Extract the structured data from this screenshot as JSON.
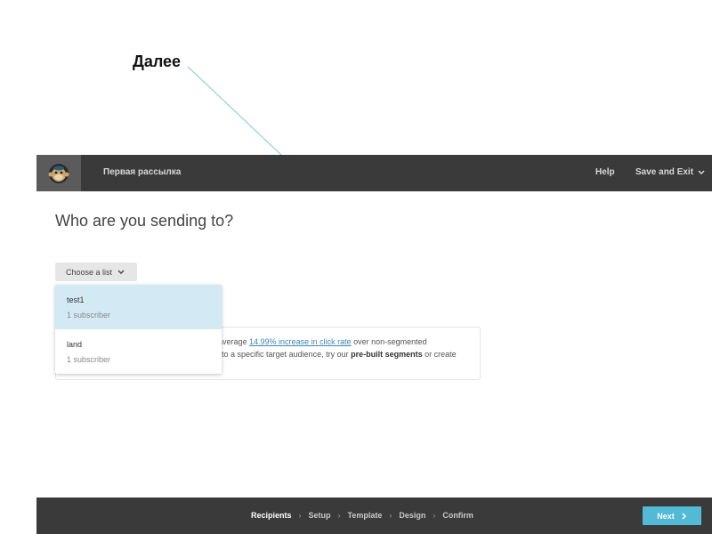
{
  "annotation": {
    "label": "Далее"
  },
  "header": {
    "campaign_name": "Первая рассылка",
    "help": "Help",
    "save_exit": "Save and Exit"
  },
  "main": {
    "heading": "Who are you sending to?",
    "choose_list": "Choose a list",
    "list_options": [
      {
        "name": "test1",
        "subscribers": "1 subscriber",
        "highlighted": true
      },
      {
        "name": "land",
        "subscribers": "1 subscriber",
        "highlighted": false
      }
    ],
    "info": {
      "line1_before": "average ",
      "line1_link": "14.99% increase in click rate",
      "line1_after": " over non-segmented",
      "line2_before": "to a specific target audience, try our ",
      "line2_bold": "pre-built segments",
      "line2_after": " or create"
    }
  },
  "footer": {
    "steps": [
      "Recipients",
      "Setup",
      "Template",
      "Design",
      "Confirm"
    ],
    "current_step": "Recipients",
    "next": "Next"
  },
  "colors": {
    "topbar": "#3a3a3a",
    "accent": "#52bad5",
    "dropdown_highlight": "#d3eaf4",
    "link": "#3f86b5",
    "annotation_line": "#7fc9cf"
  },
  "icons": {
    "logo": "mailchimp-monkey-icon",
    "save_exit_chevron": "chevron-down-icon",
    "choose_list_chevron": "chevron-down-icon",
    "step_separator": "chevron-right-icon",
    "next_arrow": "chevron-right-icon"
  }
}
